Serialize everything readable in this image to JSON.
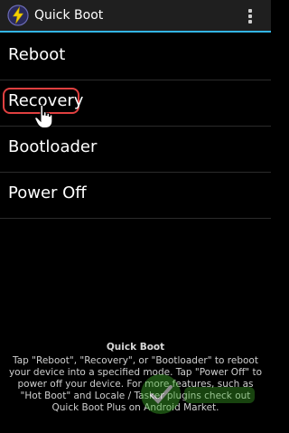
{
  "app": {
    "title": "Quick Boot",
    "icon": "lightning-bolt-icon",
    "menu_icon": "overflow-menu-icon"
  },
  "menu": {
    "items": [
      {
        "label": "Reboot"
      },
      {
        "label": "Recovery",
        "highlighted": true
      },
      {
        "label": "Bootloader"
      },
      {
        "label": "Power Off"
      }
    ]
  },
  "info": {
    "title": "Quick Boot",
    "body": "Tap \"Reboot\", \"Recovery\", or \"Bootloader\" to reboot your device into a specified mode. Tap \"Power Off\" to power off your device. For more features, such as \"Hot Boot\" and Locale / Tasker plugins check out Quick Boot Plus on Android Market."
  },
  "colors": {
    "accent": "#33b5e5",
    "highlight": "#e04040",
    "background": "#000000"
  }
}
